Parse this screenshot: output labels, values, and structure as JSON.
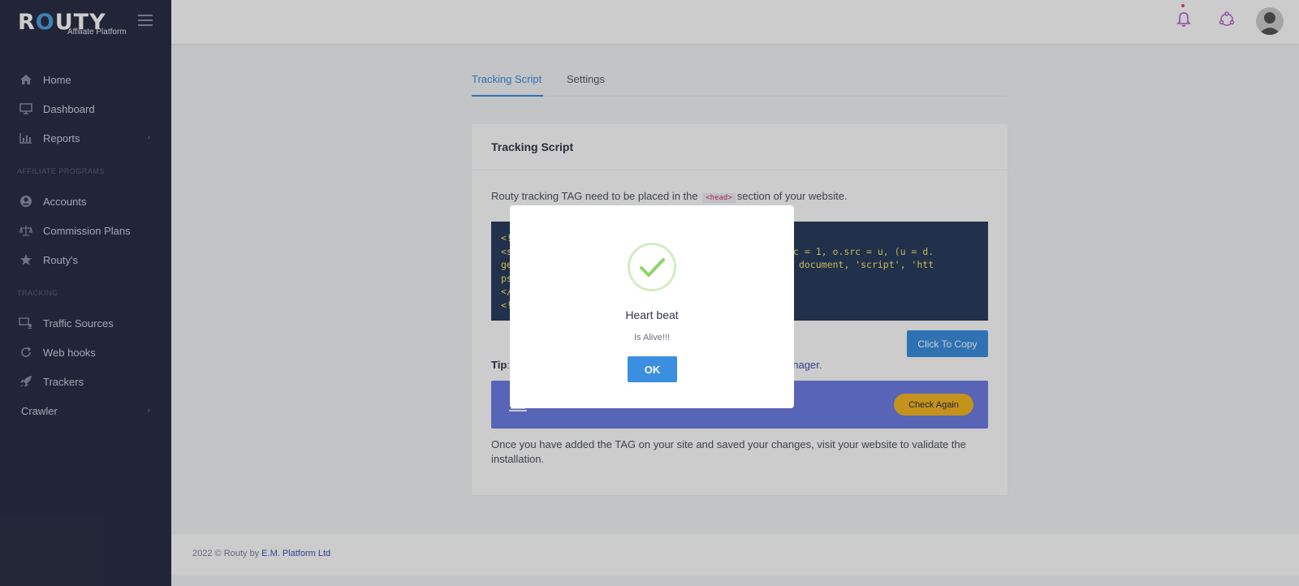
{
  "brand": {
    "logo_text_a": "R",
    "logo_text_o": "O",
    "logo_text_b": "UTY",
    "tagline": "Affiliate Platform"
  },
  "sidebar": {
    "items": [
      {
        "label": "Home",
        "icon": "home-icon"
      },
      {
        "label": "Dashboard",
        "icon": "monitor-icon"
      },
      {
        "label": "Reports",
        "icon": "bar-chart-icon",
        "has_children": true
      }
    ],
    "section_affiliate": "AFFILIATE PROGRAMS",
    "affiliate_items": [
      {
        "label": "Accounts",
        "icon": "user-circle-icon"
      },
      {
        "label": "Commission Plans",
        "icon": "scale-icon"
      },
      {
        "label": "Routy's",
        "icon": "star-icon"
      }
    ],
    "section_tracking": "TRACKING",
    "tracking_items": [
      {
        "label": "Traffic Sources",
        "icon": "signpost-icon"
      },
      {
        "label": "Web hooks",
        "icon": "refresh-icon"
      },
      {
        "label": "Trackers",
        "icon": "rocket-icon"
      },
      {
        "label": "Crawler",
        "icon": "",
        "has_children": true
      }
    ]
  },
  "tabs": [
    "Tracking Script",
    "Settings"
  ],
  "card": {
    "title": "Tracking Script",
    "lead_before": "Routy tracking TAG need to be placed in the",
    "lead_code": "<head>",
    "lead_after": "section of your website.",
    "code_lines": [
      "<!",
      "<s                                        t(t)).async = 1, o.src = u, (u = d.",
      "ge                                        )}(window, document, 'script', 'htt",
      "ps                                         'Routy');",
      "</",
      "<!"
    ],
    "copy_label": "Click To Copy",
    "tip_label": "Tip",
    "tip_colon": ":",
    "tip_link": "anager.",
    "check_label": "Check Again",
    "outro": "Once you have added the TAG on your site and saved your changes, visit your website to validate the installation."
  },
  "footer": {
    "text": "2022 © Routy by",
    "link": "E.M. Platform Ltd"
  },
  "modal": {
    "title": "Heart beat",
    "text": "Is Alive!!!",
    "ok_label": "OK"
  },
  "colors": {
    "sidebar": "#2b2f45",
    "accent": "#3a8fe0",
    "alert": "#6e7ee3",
    "warn": "#f5b824",
    "code_bg": "#2a3d5e",
    "success": "#8dd46a"
  }
}
